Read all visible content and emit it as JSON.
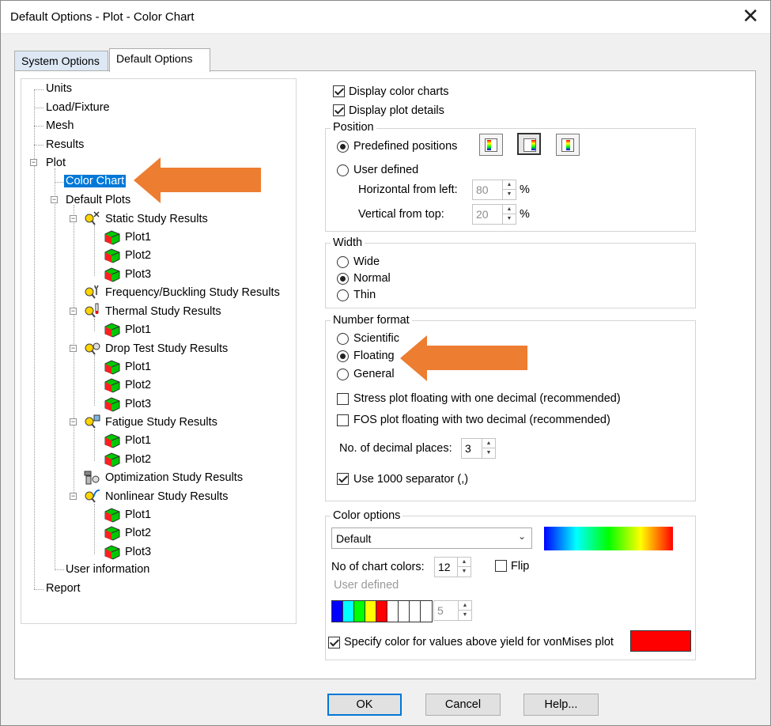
{
  "window": {
    "title": "Default Options - Plot - Color Chart",
    "close_glyph": "✕"
  },
  "tabs": [
    {
      "label": "System Options",
      "active": false
    },
    {
      "label": "Default Options",
      "active": true
    }
  ],
  "tree": {
    "units": "Units",
    "load_fixture": "Load/Fixture",
    "mesh": "Mesh",
    "results": "Results",
    "plot": "Plot",
    "color_chart": "Color Chart",
    "default_plots": "Default Plots",
    "static": "Static Study Results",
    "static_plots": [
      "Plot1",
      "Plot2",
      "Plot3"
    ],
    "frequency": "Frequency/Buckling Study Results",
    "thermal": "Thermal Study Results",
    "thermal_plots": [
      "Plot1"
    ],
    "drop": "Drop Test Study Results",
    "drop_plots": [
      "Plot1",
      "Plot2",
      "Plot3"
    ],
    "fatigue": "Fatigue Study Results",
    "fatigue_plots": [
      "Plot1",
      "Plot2"
    ],
    "optimization": "Optimization Study Results",
    "nonlinear": "Nonlinear Study Results",
    "nonlinear_plots": [
      "Plot1",
      "Plot2",
      "Plot3"
    ],
    "user_information": "User information",
    "report": "Report"
  },
  "options": {
    "display_color_charts": {
      "label": "Display color charts",
      "checked": true
    },
    "display_plot_details": {
      "label": "Display plot details",
      "checked": true
    }
  },
  "position": {
    "title": "Position",
    "predefined_label": "Predefined positions",
    "user_defined_label": "User defined",
    "horizontal_label": "Horizontal from left:",
    "horizontal_value": "80",
    "vertical_label": "Vertical from top:",
    "vertical_value": "20",
    "unit": "%"
  },
  "width": {
    "title": "Width",
    "options": [
      "Wide",
      "Normal",
      "Thin"
    ],
    "selected": "Normal"
  },
  "number_format": {
    "title": "Number format",
    "options": [
      "Scientific",
      "Floating",
      "General"
    ],
    "selected": "Floating",
    "stress_label": "Stress plot floating with one decimal (recommended)",
    "fos_label": "FOS plot floating with two decimal (recommended)",
    "decimal_label": "No. of decimal places:",
    "decimal_value": "3",
    "separator_label": "Use 1000 separator (,)"
  },
  "color_options": {
    "title": "Color options",
    "scheme": "Default",
    "chart_colors_label": "No of chart colors:",
    "chart_colors_value": "12",
    "flip_label": "Flip",
    "user_defined_label": "User defined",
    "user_defined_value": "5",
    "swatch_colors": [
      "#0000ff",
      "#00ffff",
      "#00ff00",
      "#ffff00",
      "#ff0000",
      "#ffffff",
      "#ffffff",
      "#ffffff",
      "#ffffff"
    ],
    "yield_label": "Specify color for values above yield for vonMises plot",
    "yield_color": "#ff0000"
  },
  "buttons": {
    "ok": "OK",
    "cancel": "Cancel",
    "help": "Help..."
  },
  "accent_colors": {
    "selection": "#0078d7",
    "annotation_arrow": "#ed7d31"
  }
}
